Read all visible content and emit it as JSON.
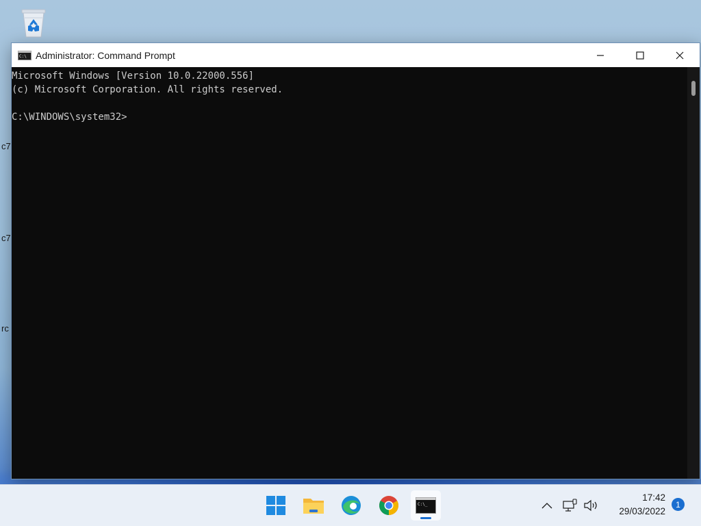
{
  "desktop": {
    "partial_labels": [
      "c7",
      "c7",
      "rc"
    ]
  },
  "window": {
    "title": "Administrator: Command Prompt",
    "controls": [
      "minimize",
      "maximize",
      "close"
    ]
  },
  "console": {
    "lines": [
      "Microsoft Windows [Version 10.0.22000.556]",
      "(c) Microsoft Corporation. All rights reserved.",
      "",
      "C:\\WINDOWS\\system32>"
    ]
  },
  "taskbar": {
    "apps": [
      {
        "name": "Start",
        "icon": "windows-start-icon"
      },
      {
        "name": "File Explorer",
        "icon": "folder-icon"
      },
      {
        "name": "Microsoft Edge",
        "icon": "edge-icon"
      },
      {
        "name": "Google Chrome",
        "icon": "chrome-icon"
      },
      {
        "name": "Command Prompt",
        "icon": "cmd-icon",
        "active": true
      }
    ],
    "tray": {
      "time": "17:42",
      "date": "29/03/2022",
      "notification_count": "1"
    }
  },
  "colors": {
    "console_bg": "#0c0c0c",
    "console_text": "#cccccc",
    "accent": "#1a6ed0"
  }
}
